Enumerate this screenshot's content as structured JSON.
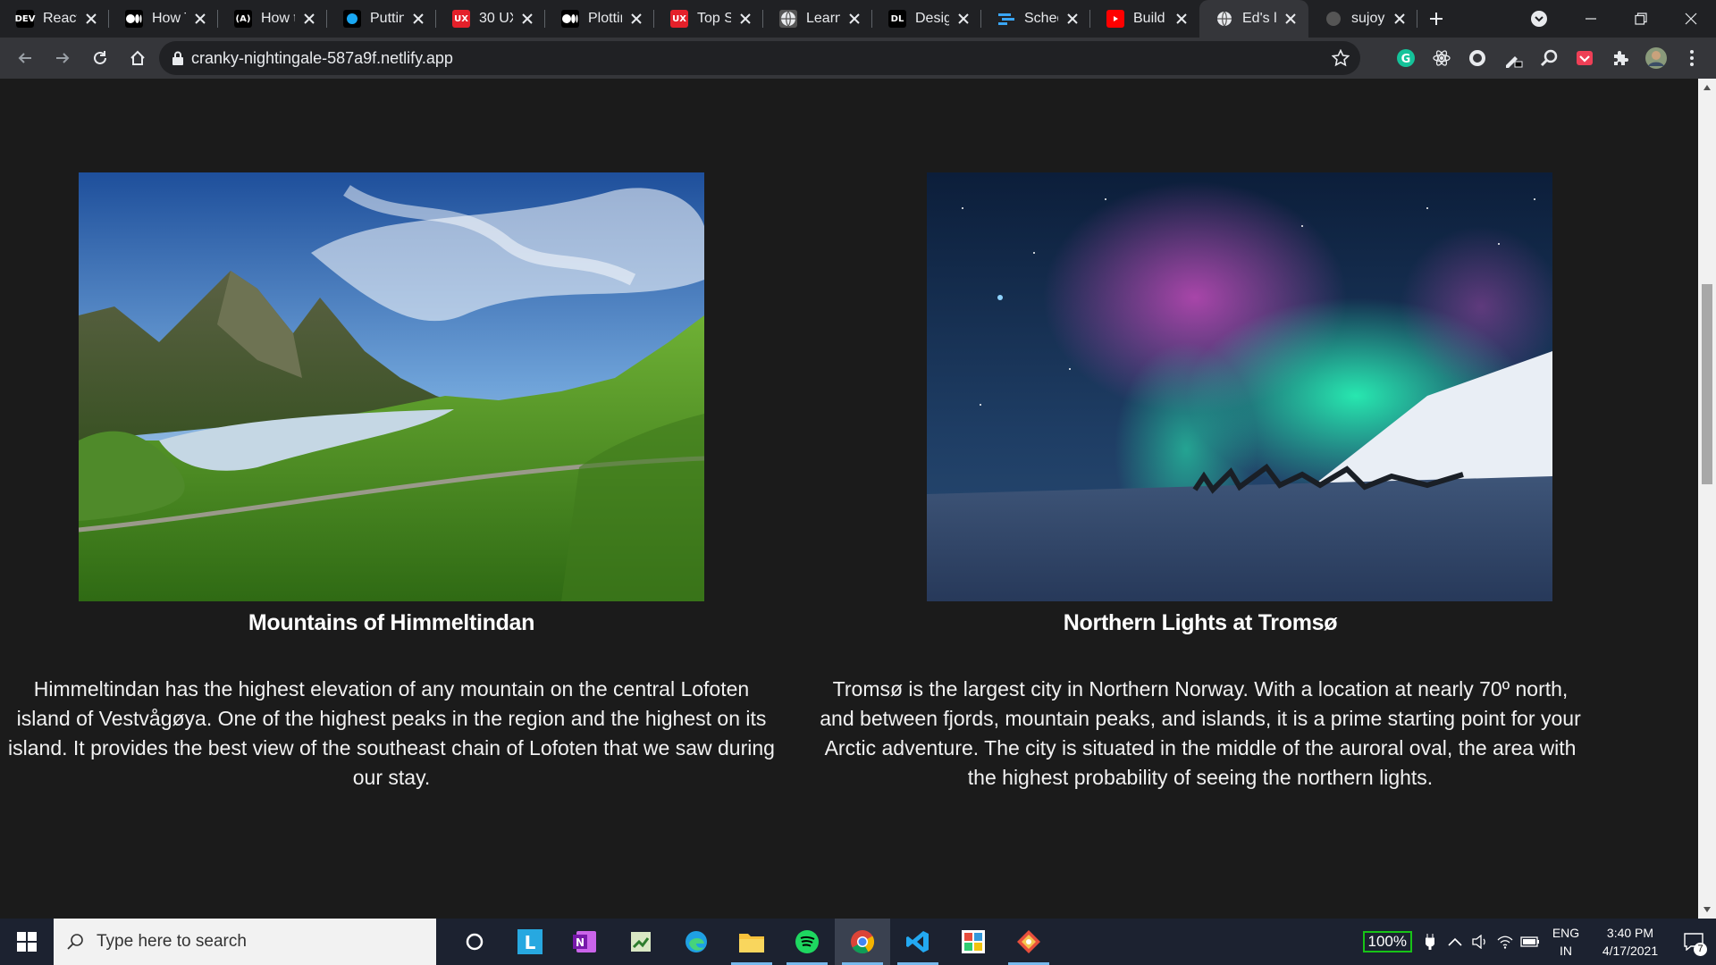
{
  "browser": {
    "tabs": [
      {
        "title": "React:",
        "favicon": "DEV",
        "favicon_bg": "#000000"
      },
      {
        "title": "How T",
        "favicon": "M",
        "favicon_bg": "#000000"
      },
      {
        "title": "How t",
        "favicon": "(A)",
        "favicon_bg": "#000000"
      },
      {
        "title": "Puttin",
        "favicon": "dot",
        "favicon_bg": "#000000"
      },
      {
        "title": "30 UX",
        "favicon": "UX",
        "favicon_bg": "#e4202a"
      },
      {
        "title": "Plottin",
        "favicon": "M",
        "favicon_bg": "#000000"
      },
      {
        "title": "Top Sk",
        "favicon": "UX",
        "favicon_bg": "#e4202a"
      },
      {
        "title": "Learn",
        "favicon": "globe",
        "favicon_bg": "#555555"
      },
      {
        "title": "Desig",
        "favicon": "DL",
        "favicon_bg": "#000000"
      },
      {
        "title": "Sched",
        "favicon": "bars",
        "favicon_bg": "#202124"
      },
      {
        "title": "Build",
        "favicon": "yt",
        "favicon_bg": "#ff0000"
      },
      {
        "title": "Ed's lo",
        "favicon": "globe",
        "favicon_bg": "#35363a",
        "active": true
      },
      {
        "title": "sujoyc",
        "favicon": "github",
        "favicon_bg": "#202124"
      }
    ],
    "url": "cranky-nightingale-587a9f.netlify.app"
  },
  "page": {
    "cards": [
      {
        "title": "Mountains of Himmeltindan",
        "text": "Himmeltindan has the highest elevation of any mountain on the central Lofoten island of Vestvågøya. One of the highest peaks in the region and the highest on its island. It provides the best view of the southeast chain of Lofoten that we saw during our stay.",
        "image": "mountain-landscape-photo"
      },
      {
        "title": "Northern Lights at Tromsø",
        "text": "Tromsø is the largest city in Northern Norway. With a location at nearly 70º north, and between fjords, mountain peaks, and islands, it is a prime starting point for your Arctic adventure. The city is situated in the middle of the auroral oval, the area with the highest probability of seeing the northern lights.",
        "image": "northern-lights-photo"
      }
    ]
  },
  "taskbar": {
    "search_placeholder": "Type here to search",
    "battery": "100%",
    "language": "ENG",
    "region": "IN",
    "time": "3:40 PM",
    "date": "4/17/2021",
    "notifications": "7"
  }
}
